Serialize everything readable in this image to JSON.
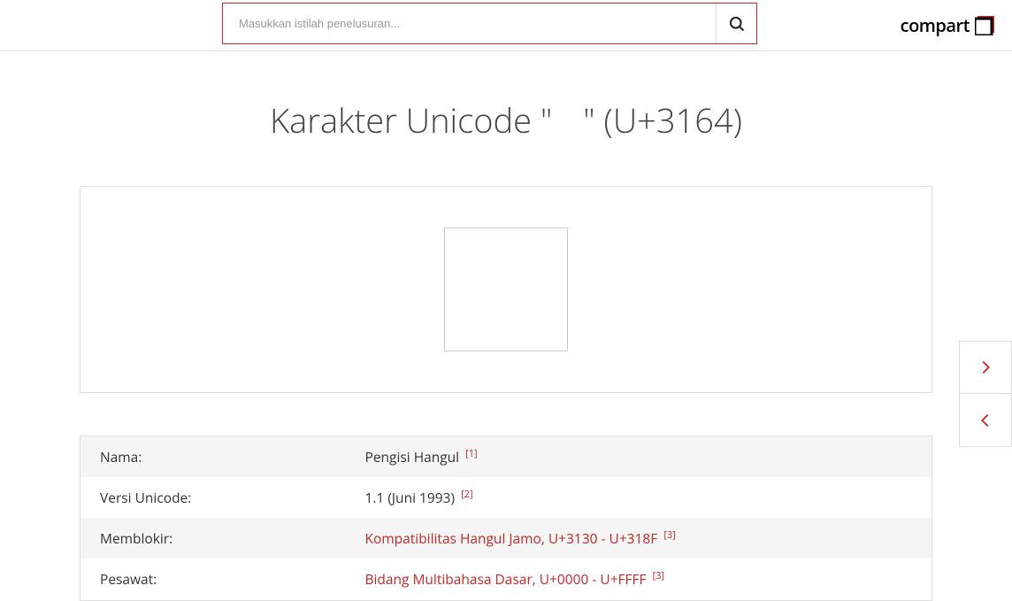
{
  "search": {
    "placeholder": "Masukkan istilah penelusuran..."
  },
  "logo": {
    "text": "compart"
  },
  "title": "Karakter Unicode \"ㅤ\" (U+3164)",
  "character": "ㅤ",
  "rows": {
    "name": {
      "label": "Nama:",
      "value": "Pengisi Hangul",
      "fn": "[1]"
    },
    "version": {
      "label": "Versi Unicode:",
      "value": "1.1 (Juni 1993)",
      "fn": "[2]"
    },
    "block": {
      "label": "Memblokir:",
      "value": "Kompatibilitas Hangul Jamo, U+3130 - U+318F",
      "fn": "[3]"
    },
    "plane": {
      "label": "Pesawat:",
      "value": "Bidang Multibahasa Dasar, U+0000 - U+FFFF",
      "fn": "[3]"
    }
  }
}
